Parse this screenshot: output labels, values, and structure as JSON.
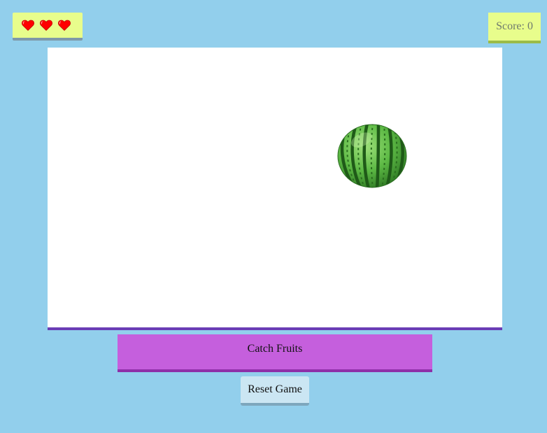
{
  "hud": {
    "lives": {
      "count": 3,
      "icon": "heart-icon",
      "color": "#ff0000"
    },
    "score_label": "Score: 0"
  },
  "game": {
    "falling_fruit": "watermelon-icon"
  },
  "controls": {
    "catch_label": "Catch Fruits",
    "reset_label": "Reset Game"
  },
  "colors": {
    "background": "#92cfec",
    "hud_panel": "#e8fd8c",
    "catch_bar": "#c55fdd",
    "catch_bar_border": "#8e2fa8",
    "game_border": "#6a3db5",
    "reset_button": "#cbe6f3"
  }
}
